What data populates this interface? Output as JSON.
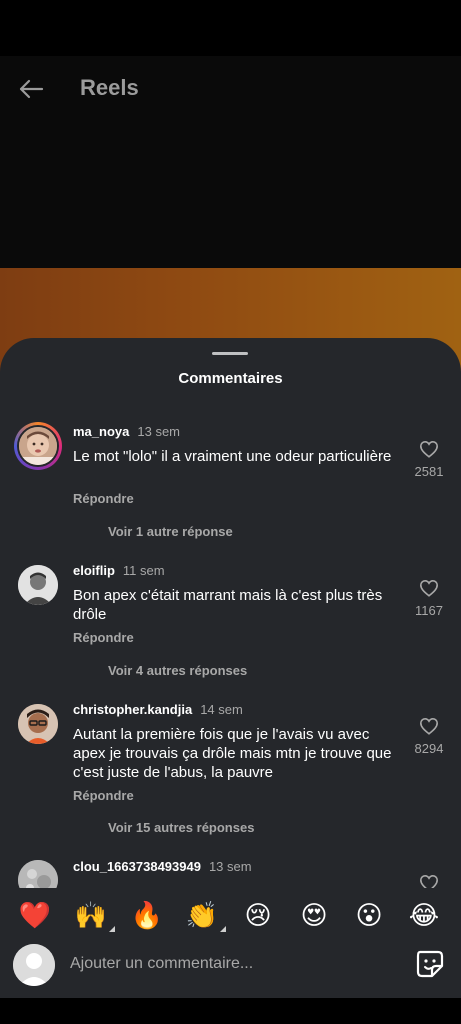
{
  "header": {
    "title": "Reels"
  },
  "sheet": {
    "title": "Commentaires"
  },
  "comments": [
    {
      "username": "ma_noya",
      "time": "13 sem",
      "text": "Le mot \"lolo\" il a vraiment une odeur particulière",
      "reply": "Répondre",
      "more": "Voir 1 autre réponse",
      "likes": "2581"
    },
    {
      "username": "eloiflip",
      "time": "11 sem",
      "text": "Bon apex c'était marrant mais là c'est plus très drôle",
      "reply": "Répondre",
      "more": "Voir 4 autres réponses",
      "likes": "1167"
    },
    {
      "username": "christopher.kandjia",
      "time": "14 sem",
      "text": "Autant la première fois que je l'avais vu avec apex je trouvais ça drôle mais mtn je trouve que c'est juste de l'abus, la pauvre",
      "reply": "Répondre",
      "more": "Voir 15 autres réponses",
      "likes": "8294"
    },
    {
      "username": "clou_1663738493949",
      "time": "13 sem"
    }
  ],
  "emojis": [
    "❤️",
    "🙌",
    "🔥",
    "👏",
    "😢",
    "😍",
    "😮",
    "😂"
  ],
  "composer": {
    "placeholder": "Ajouter un commentaire..."
  },
  "colors": {
    "sheet_bg": "#25272b",
    "accent_orange": "#9a5812",
    "muted_text": "#a8a8a8"
  }
}
